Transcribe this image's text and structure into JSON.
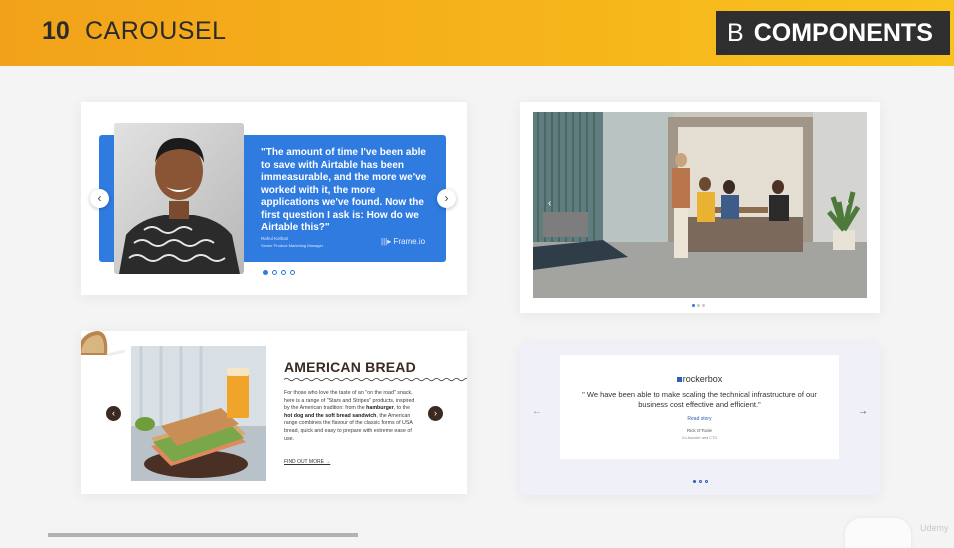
{
  "header": {
    "number": "10",
    "title": "CAROUSEL",
    "section_letter": "B",
    "section_title": "COMPONENTS"
  },
  "card1": {
    "quote": "\"The amount of time I've been able to save with Airtable has been immeasurable, and the more we've worked with it, the more applications we've found. Now the first question I ask is: How do we Airtable this?\"",
    "author_name": "Rahul Kothari",
    "author_role": "Senior Product Marketing Manager",
    "logo": "Frame.io",
    "prev_icon": "chevron-left-icon",
    "next_icon": "chevron-right-icon",
    "active_dot": 1,
    "accent_color": "#2f7be0"
  },
  "card2": {
    "active_dot": 1
  },
  "card3": {
    "title": "AMERICAN BREAD",
    "link": "FIND OUT MORE →",
    "accent_color": "#3a2a22"
  },
  "card4": {
    "logo": "rockerbox",
    "quote": "\" We have been able to make scaling the technical infrastructure of our business cost effective and efficient.\"",
    "read_story": "Read story",
    "name": "Rick O'Toole",
    "role": "Co-founder and CTO",
    "active_dot": 1
  },
  "watermark": "Udemy"
}
